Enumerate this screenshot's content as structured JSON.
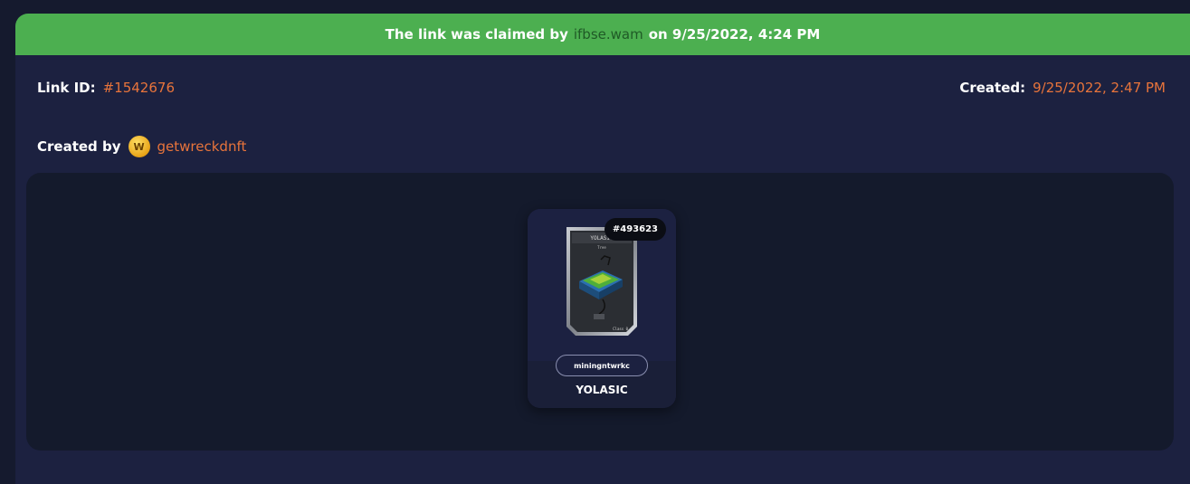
{
  "banner": {
    "prefix": "The link was claimed by",
    "claimer": "ifbse.wam",
    "suffix": "on 9/25/2022, 4:24 PM"
  },
  "link": {
    "label": "Link ID:",
    "value": "#1542676"
  },
  "created": {
    "label": "Created:",
    "value": "9/25/2022, 2:47 PM"
  },
  "creator": {
    "label": "Created by",
    "name": "getwreckdnft",
    "avatar_icon": "wax-coin-icon"
  },
  "nft_card": {
    "asset_badge": "#493623",
    "owner": "miningntwrkc",
    "name": "YOLASIC",
    "image_title": "YOLASIC",
    "image_subtitle": "Tree",
    "image_footer": "Class 0"
  },
  "colors": {
    "banner": "#4caf50",
    "accent": "#e8743b",
    "panel": "#1c2140",
    "inner": "#141a2c"
  }
}
